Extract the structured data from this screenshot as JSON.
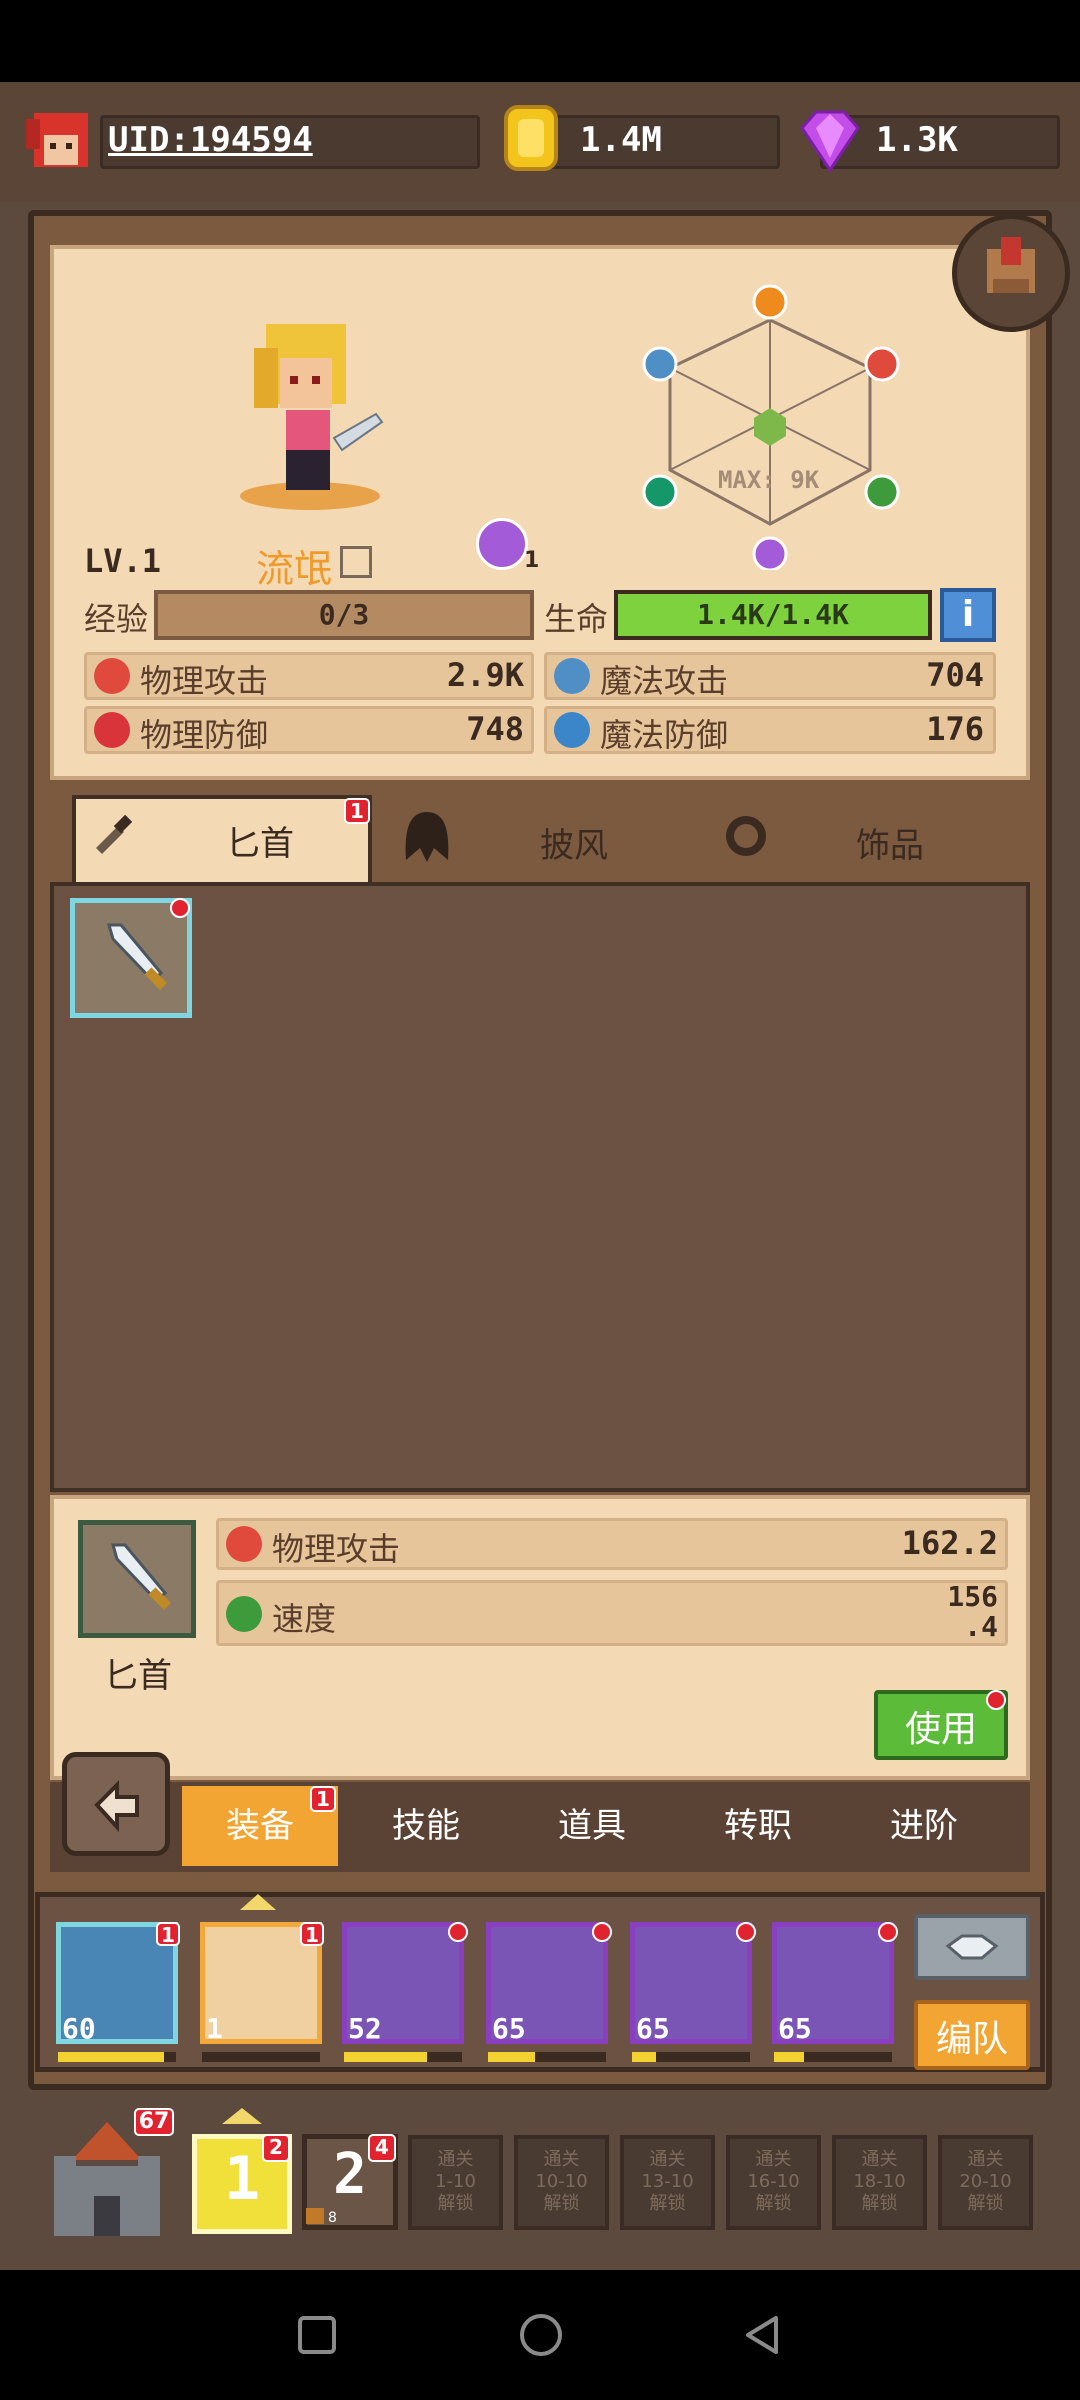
{
  "header": {
    "uid": "UID:194594",
    "gold": "1.4M",
    "gems": "1.3K"
  },
  "character": {
    "level": "LV.1",
    "name": "流氓",
    "skill_points": "1",
    "exp_label": "经验",
    "exp_value": "0/3",
    "exp_progress": 0,
    "hp_label": "生命",
    "hp_value": "1.4K/1.4K",
    "hp_progress": 1,
    "radar_max": "MAX: 9K",
    "stats": [
      {
        "label": "物理攻击",
        "value": "2.9K"
      },
      {
        "label": "魔法攻击",
        "value": "704"
      },
      {
        "label": "物理防御",
        "value": "748"
      },
      {
        "label": "魔法防御",
        "value": "176"
      }
    ]
  },
  "equip_tabs": [
    {
      "label": "匕首",
      "badge": "1"
    },
    {
      "label": "披风"
    },
    {
      "label": "饰品"
    }
  ],
  "detail": {
    "item_name": "匕首",
    "stats": [
      {
        "label": "物理攻击",
        "value": "162.2"
      },
      {
        "label": "速度",
        "value_line1": "156",
        "value_line2": ".4"
      }
    ],
    "use_button": "使用"
  },
  "bottom_tabs": [
    {
      "label": "装备",
      "badge": "1"
    },
    {
      "label": "技能"
    },
    {
      "label": "道具"
    },
    {
      "label": "转职"
    },
    {
      "label": "进阶"
    }
  ],
  "party": {
    "heroes": [
      {
        "level": "60",
        "badge": "1"
      },
      {
        "level": "1",
        "badge": "1"
      },
      {
        "level": "52"
      },
      {
        "level": "65"
      },
      {
        "level": "65"
      },
      {
        "level": "65"
      }
    ],
    "team_button": "编队"
  },
  "stages": {
    "castle_level": "67",
    "slot1": "1",
    "slot1_badge": "2",
    "slot2": "2",
    "slot2_badge": "4",
    "slot2_sub": "8",
    "locked": [
      {
        "line1": "通关",
        "line2": "1-10",
        "line3": "解锁"
      },
      {
        "line1": "通关",
        "line2": "10-10",
        "line3": "解锁"
      },
      {
        "line1": "通关",
        "line2": "13-10",
        "line3": "解锁"
      },
      {
        "line1": "通关",
        "line2": "16-10",
        "line3": "解锁"
      },
      {
        "line1": "通关",
        "line2": "18-10",
        "line3": "解锁"
      },
      {
        "line1": "通关",
        "line2": "20-10",
        "line3": "解锁"
      }
    ]
  }
}
